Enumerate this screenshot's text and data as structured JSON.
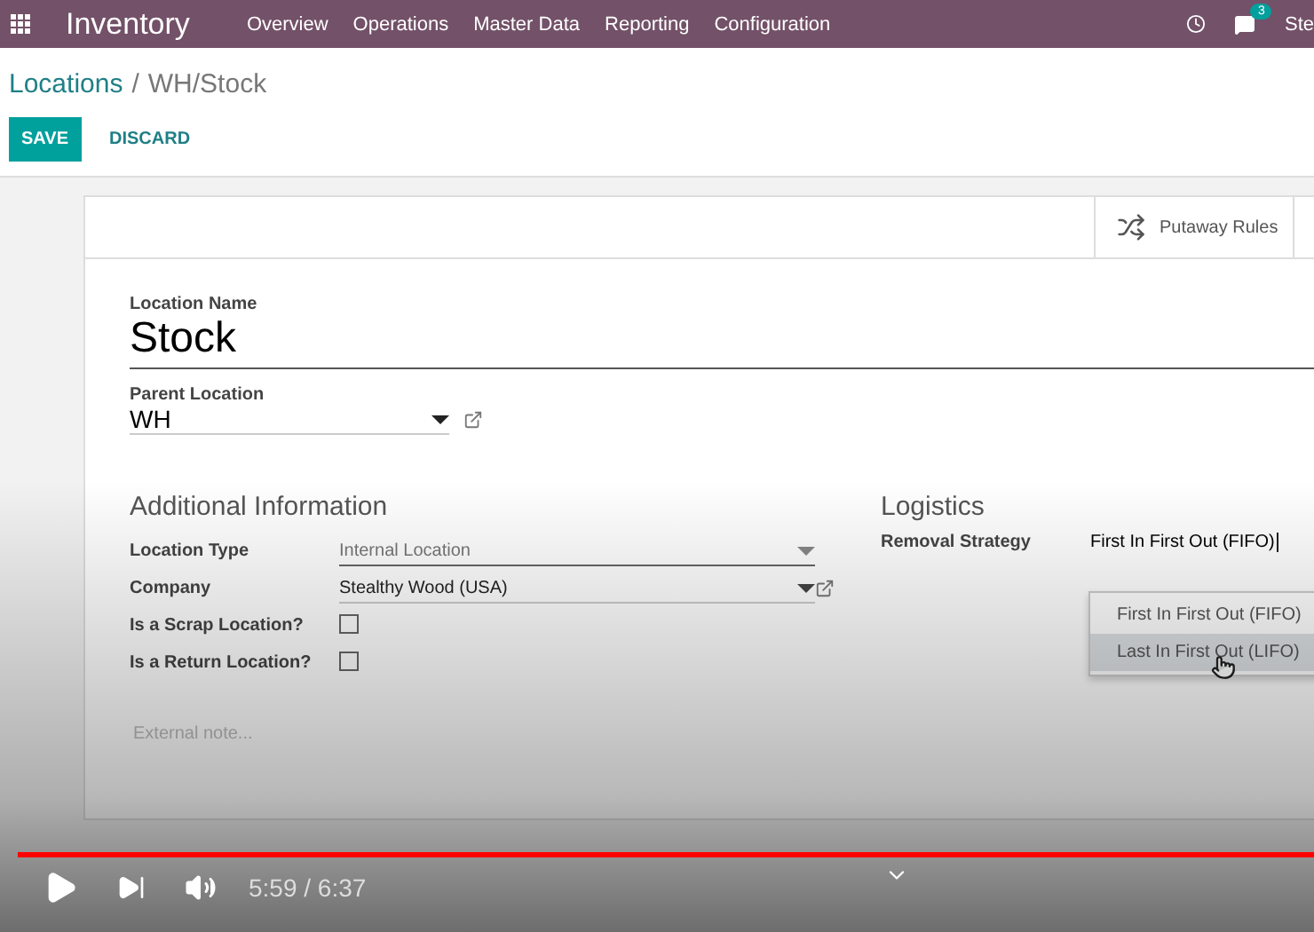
{
  "navbar": {
    "app_name": "Inventory",
    "menu": [
      "Overview",
      "Operations",
      "Master Data",
      "Reporting",
      "Configuration"
    ],
    "message_count": "3",
    "user": "Ste"
  },
  "breadcrumb": {
    "parent": "Locations",
    "separator": "/",
    "current": "WH/Stock"
  },
  "actions": {
    "save": "SAVE",
    "discard": "DISCARD"
  },
  "button_box": [
    {
      "kind": "putaway",
      "label": "Putaway Rules"
    },
    {
      "kind": "stock"
    }
  ],
  "form": {
    "name_label": "Location Name",
    "name_value": "Stock",
    "parent_label": "Parent Location",
    "parent_value": "WH",
    "additional": {
      "title": "Additional Information",
      "fields": [
        {
          "kind": "select",
          "label": "Location Type",
          "value": "Internal Location",
          "external_link": false,
          "muted": true
        },
        {
          "kind": "select",
          "label": "Company",
          "value": "Stealthy Wood (USA)",
          "external_link": true,
          "muted": false
        },
        {
          "kind": "checkbox",
          "label": "Is a Scrap Location?",
          "checked": false
        },
        {
          "kind": "checkbox",
          "label": "Is a Return Location?",
          "checked": false
        }
      ]
    },
    "logistics": {
      "title": "Logistics",
      "removal_label": "Removal Strategy",
      "removal_value": "First In First Out (FIFO)",
      "options": [
        {
          "label": "First In First Out (FIFO)",
          "highlighted": false
        },
        {
          "label": "Last In First Out (LIFO)",
          "highlighted": true
        }
      ]
    },
    "note_placeholder": "External note..."
  },
  "player": {
    "progress": {
      "level": 1
    },
    "time": "5:59 / 6:37",
    "playing": false
  }
}
